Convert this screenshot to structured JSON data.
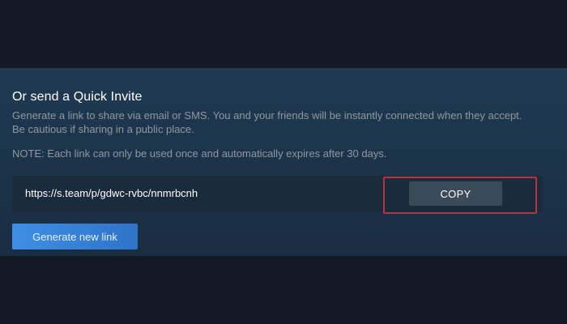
{
  "quick_invite": {
    "heading": "Or send a Quick Invite",
    "description": "Generate a link to share via email or SMS. You and your friends will be instantly connected when they accept. Be cautious if sharing in a public place.",
    "note": "NOTE: Each link can only be used once and automatically expires after 30 days.",
    "invite_link": "https://s.team/p/gdwc-rvbc/nnmrbcnh",
    "copy_label": "COPY",
    "generate_label": "Generate new link"
  },
  "colors": {
    "panel_background": "#1f3a52",
    "page_background": "#141923",
    "link_row_background": "#1a2b3c",
    "copy_button": "#3b4a58",
    "generate_button": "#3e8fe6",
    "highlight_border": "#b8333f",
    "secondary_text": "#8f98a0"
  }
}
